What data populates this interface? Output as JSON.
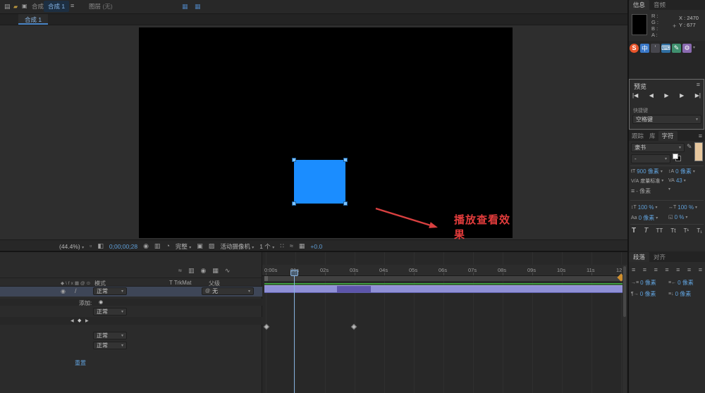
{
  "colors": {
    "accent_blue": "#5f9fd8",
    "annotation_red": "#d94040",
    "square_blue": "#1b8dff",
    "layer_bar_purple": "#8f90d6",
    "cache_green": "#3f9e3f",
    "marker_orange": "#cf8f2e"
  },
  "top_bar": {
    "composition_tab": "合成",
    "comp_name_tab": "合成 1",
    "layer_tab": "图层",
    "layer_tab_value": "(无)"
  },
  "comp_panel": {
    "nav_tab": "合成 1",
    "annotation": "播放查看效果",
    "toolbar": {
      "zoom": "(44.4%)",
      "timecode": "0;00;00;28",
      "resolution": "完整",
      "camera_view": "活动摄像机",
      "view_layout": "1 个",
      "exposure": "+0.0"
    }
  },
  "info_panel": {
    "tab_info": "信息",
    "tab_audio": "音频",
    "r_label": "R :",
    "g_label": "G :",
    "b_label": "B :",
    "a_label": "A :",
    "x_value": "X : 2470",
    "y_value": "Y : 677"
  },
  "ime_toolbar": {
    "logo": "S",
    "lang_mode": "中",
    "punct_mode": "’",
    "keyboard": "⌨",
    "pen": "✎",
    "gear": "⚙"
  },
  "preview_panel": {
    "title": "预览",
    "first_frame": "|◀",
    "prev_frame": "◀",
    "play": "▶",
    "next_frame": "▶",
    "last_frame": "▶|",
    "shortcut_label": "快捷键",
    "shortcut_value": "空格键"
  },
  "character_panel": {
    "tab_tracker": "跟踪",
    "tab_library": "库",
    "tab_character": "字符",
    "font_family": "隶书",
    "font_style": "-",
    "font_size": "900 像素",
    "leading": "0 像素",
    "kerning": "度量标准",
    "tracking": "43",
    "stroke_width": "- 像素",
    "vertical_scale": "100 %",
    "horizontal_scale": "100 %",
    "baseline_shift": "0 像素",
    "proportional_spacing": "0 %",
    "toggle_bold": "T",
    "toggle_italic": "T",
    "toggle_all_caps": "TT",
    "toggle_small_caps": "Tt",
    "toggle_superscript": "T¹",
    "toggle_subscript": "T₁"
  },
  "paragraph_panel": {
    "tab_paragraph": "段落",
    "tab_align": "对齐",
    "indent_left": "0 像素",
    "indent_right": "0 像素",
    "indent_first_line": "0 像素",
    "space_after": "0 像素"
  },
  "timeline": {
    "header": {
      "mode": "模式",
      "trkmat": "T TrkMat",
      "parent": "父级"
    },
    "mode_value": "正常",
    "parent_value": "无",
    "add_label": "添加:",
    "reset_link": "重置",
    "ruler": [
      "0:00s",
      "01s",
      "02s",
      "03s",
      "04s",
      "05s",
      "06s",
      "07s",
      "08s",
      "09s",
      "10s",
      "11s",
      "12"
    ]
  }
}
